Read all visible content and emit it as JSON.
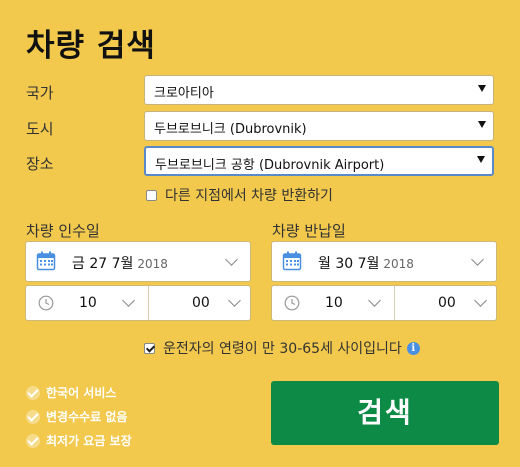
{
  "title": "차량 검색",
  "form": {
    "country_label": "국가",
    "country_value": "크로아티아",
    "city_label": "도시",
    "city_value": "두브로브니크 (Dubrovnik)",
    "location_label": "장소",
    "location_value": "두브로브니크 공항 (Dubrovnik Airport)",
    "return_other_label": "다른 지점에서 차량 반환하기",
    "return_other_checked": false
  },
  "pickup": {
    "label": "차량 인수일",
    "date": "금 27 7월",
    "year": "2018",
    "hour": "10",
    "minute": "00"
  },
  "dropoff": {
    "label": "차량 반납일",
    "date": "월 30 7월",
    "year": "2018",
    "hour": "10",
    "minute": "00"
  },
  "driver_age": {
    "label": "운전자의 연령이 만 30-65세 사이입니다",
    "checked": true
  },
  "features": [
    "한국어 서비스",
    "변경수수료 없음",
    "최저가 요금 보장"
  ],
  "search_button": "검색",
  "colors": {
    "background": "#f2c94c",
    "button": "#0d8a45",
    "active_border": "#5b8ac9",
    "info_icon": "#4a90e2"
  }
}
